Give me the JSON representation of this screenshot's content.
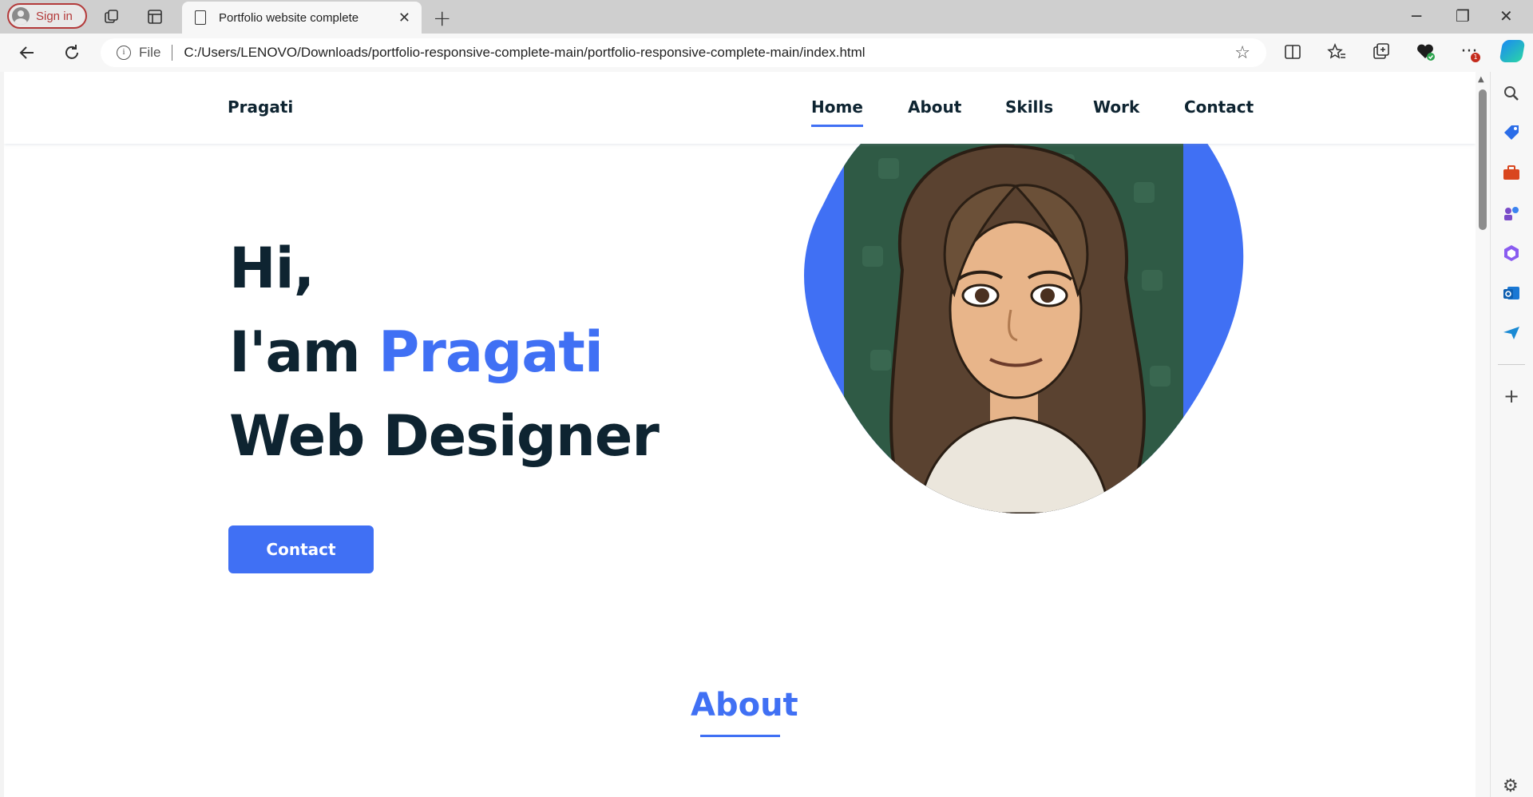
{
  "browser": {
    "signin_label": "Sign in",
    "tab_title": "Portfolio website complete",
    "tab_close": "✕",
    "new_tab": "+",
    "window_controls": {
      "minimize": "─",
      "restore": "❐",
      "close": "✕"
    },
    "address": {
      "scheme_label": "File",
      "url": "C:/Users/LENOVO/Downloads/portfolio-responsive-complete-main/portfolio-responsive-complete-main/index.html"
    },
    "notification_count": "1"
  },
  "site": {
    "logo": "Pragati",
    "nav": [
      {
        "label": "Home",
        "active": true
      },
      {
        "label": "About",
        "active": false
      },
      {
        "label": "Skills",
        "active": false
      },
      {
        "label": "Work",
        "active": false
      },
      {
        "label": "Contact",
        "active": false
      }
    ],
    "hero": {
      "line1": "Hi,",
      "line2_prefix": "I'am ",
      "line2_name": "Pragati",
      "line3": "Web Designer",
      "button": "Contact"
    },
    "about_title": "About",
    "accent_color": "#4070f4",
    "text_color": "#0e2431"
  },
  "icons": {
    "back": "back-arrow-icon",
    "refresh": "refresh-icon",
    "info": "info-icon",
    "favorite": "star-icon"
  }
}
